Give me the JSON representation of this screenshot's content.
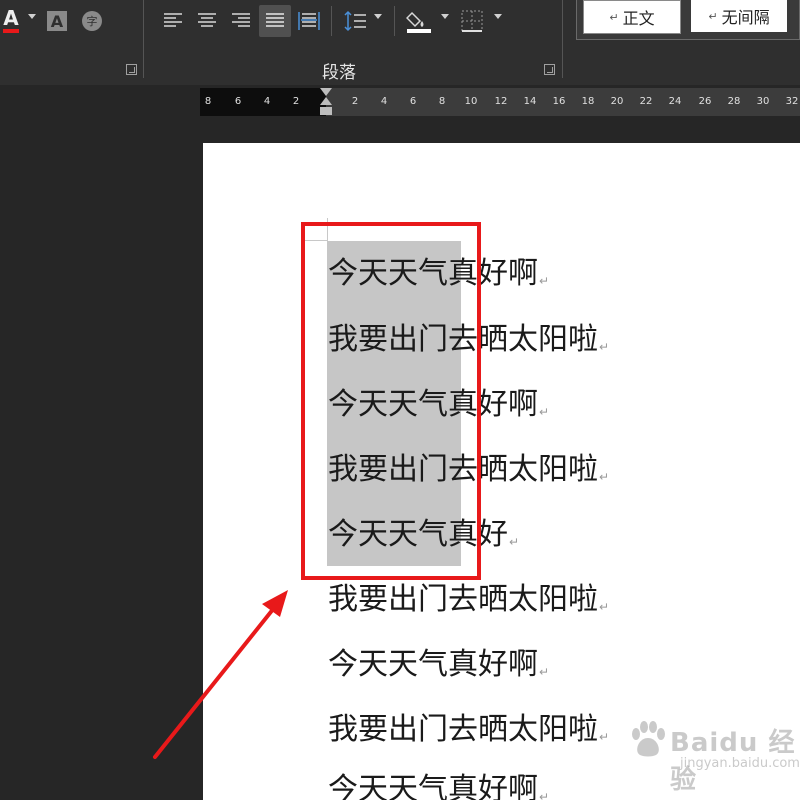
{
  "ribbon": {
    "paragraph_group_label": "段落",
    "styles": [
      {
        "label": "正文",
        "marker": "↵"
      },
      {
        "label": "无间隔",
        "marker": "↵"
      }
    ],
    "icons": {
      "font_color": "A",
      "char_shading": "A",
      "enclose_char": "字"
    }
  },
  "ruler": {
    "left_ticks": [
      "8",
      "6",
      "4",
      "2"
    ],
    "right_ticks": [
      "2",
      "4",
      "6",
      "8",
      "10",
      "12",
      "14",
      "16",
      "18",
      "20",
      "22",
      "24",
      "26",
      "28",
      "30",
      "32"
    ]
  },
  "document": {
    "lines": [
      "今天天气真好啊",
      "我要出门去晒太阳啦",
      "今天天气真好啊",
      "我要出门去晒太阳啦",
      "今天天气真好",
      "我要出门去晒太阳啦",
      "今天天气真好啊",
      "我要出门去晒太阳啦",
      "今天天气真好啊"
    ],
    "paragraph_mark": "↵"
  },
  "watermark": {
    "brand": "Baidu 经验",
    "url": "jingyan.baidu.com"
  },
  "colors": {
    "ribbon_bg": "#2f2f2f",
    "workspace_bg": "#262626",
    "selection": "#c6c6c6",
    "annotation_red": "#e8191a"
  }
}
